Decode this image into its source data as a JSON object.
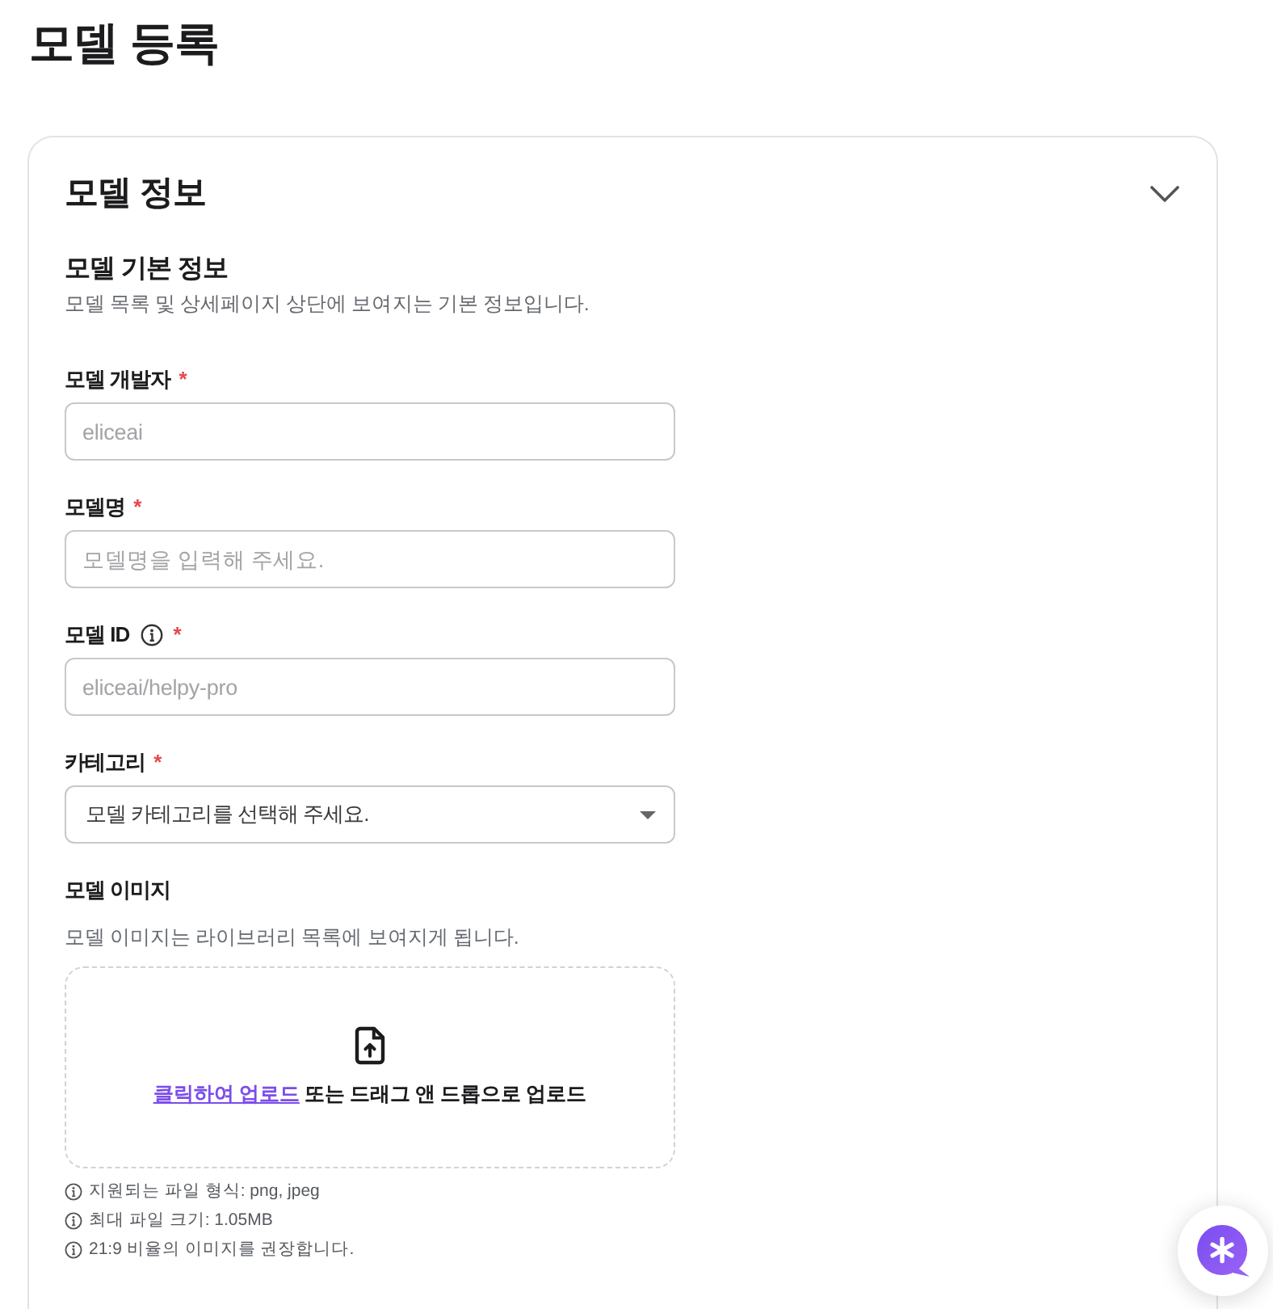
{
  "page": {
    "title": "모델 등록"
  },
  "section": {
    "title": "모델 정보",
    "expanded": true,
    "group": {
      "title": "모델 기본 정보",
      "description": "모델 목록 및 상세페이지 상단에 보여지는 기본 정보입니다."
    },
    "fields": [
      {
        "kind": "input",
        "label": "모델 개발자",
        "mark": "*",
        "placeholder": "eliceai"
      },
      {
        "kind": "input",
        "label": "모델명",
        "mark": "*",
        "placeholder": "모델명을 입력해 주세요."
      },
      {
        "kind": "input",
        "label": "모델 ID",
        "info": true,
        "mark": "*",
        "placeholder": "eliceai/helpy-pro"
      },
      {
        "kind": "select",
        "label": "카테고리",
        "mark": "*",
        "placeholder": "모델 카테고리를 선택해 주세요."
      },
      {
        "kind": "upload",
        "label": "모델 이미지",
        "description": "모델 이미지는 라이브러리 목록에 보여지게 됩니다.",
        "link": "클릭하여 업로드",
        "text": "또는 드래그 앤 드롭으로 업로드",
        "hints": [
          "지원되는 파일 형식: png, jpeg",
          "최대 파일 크기: 1.05MB",
          "21:9 비율의 이미지를 권장합니다."
        ]
      }
    ]
  }
}
